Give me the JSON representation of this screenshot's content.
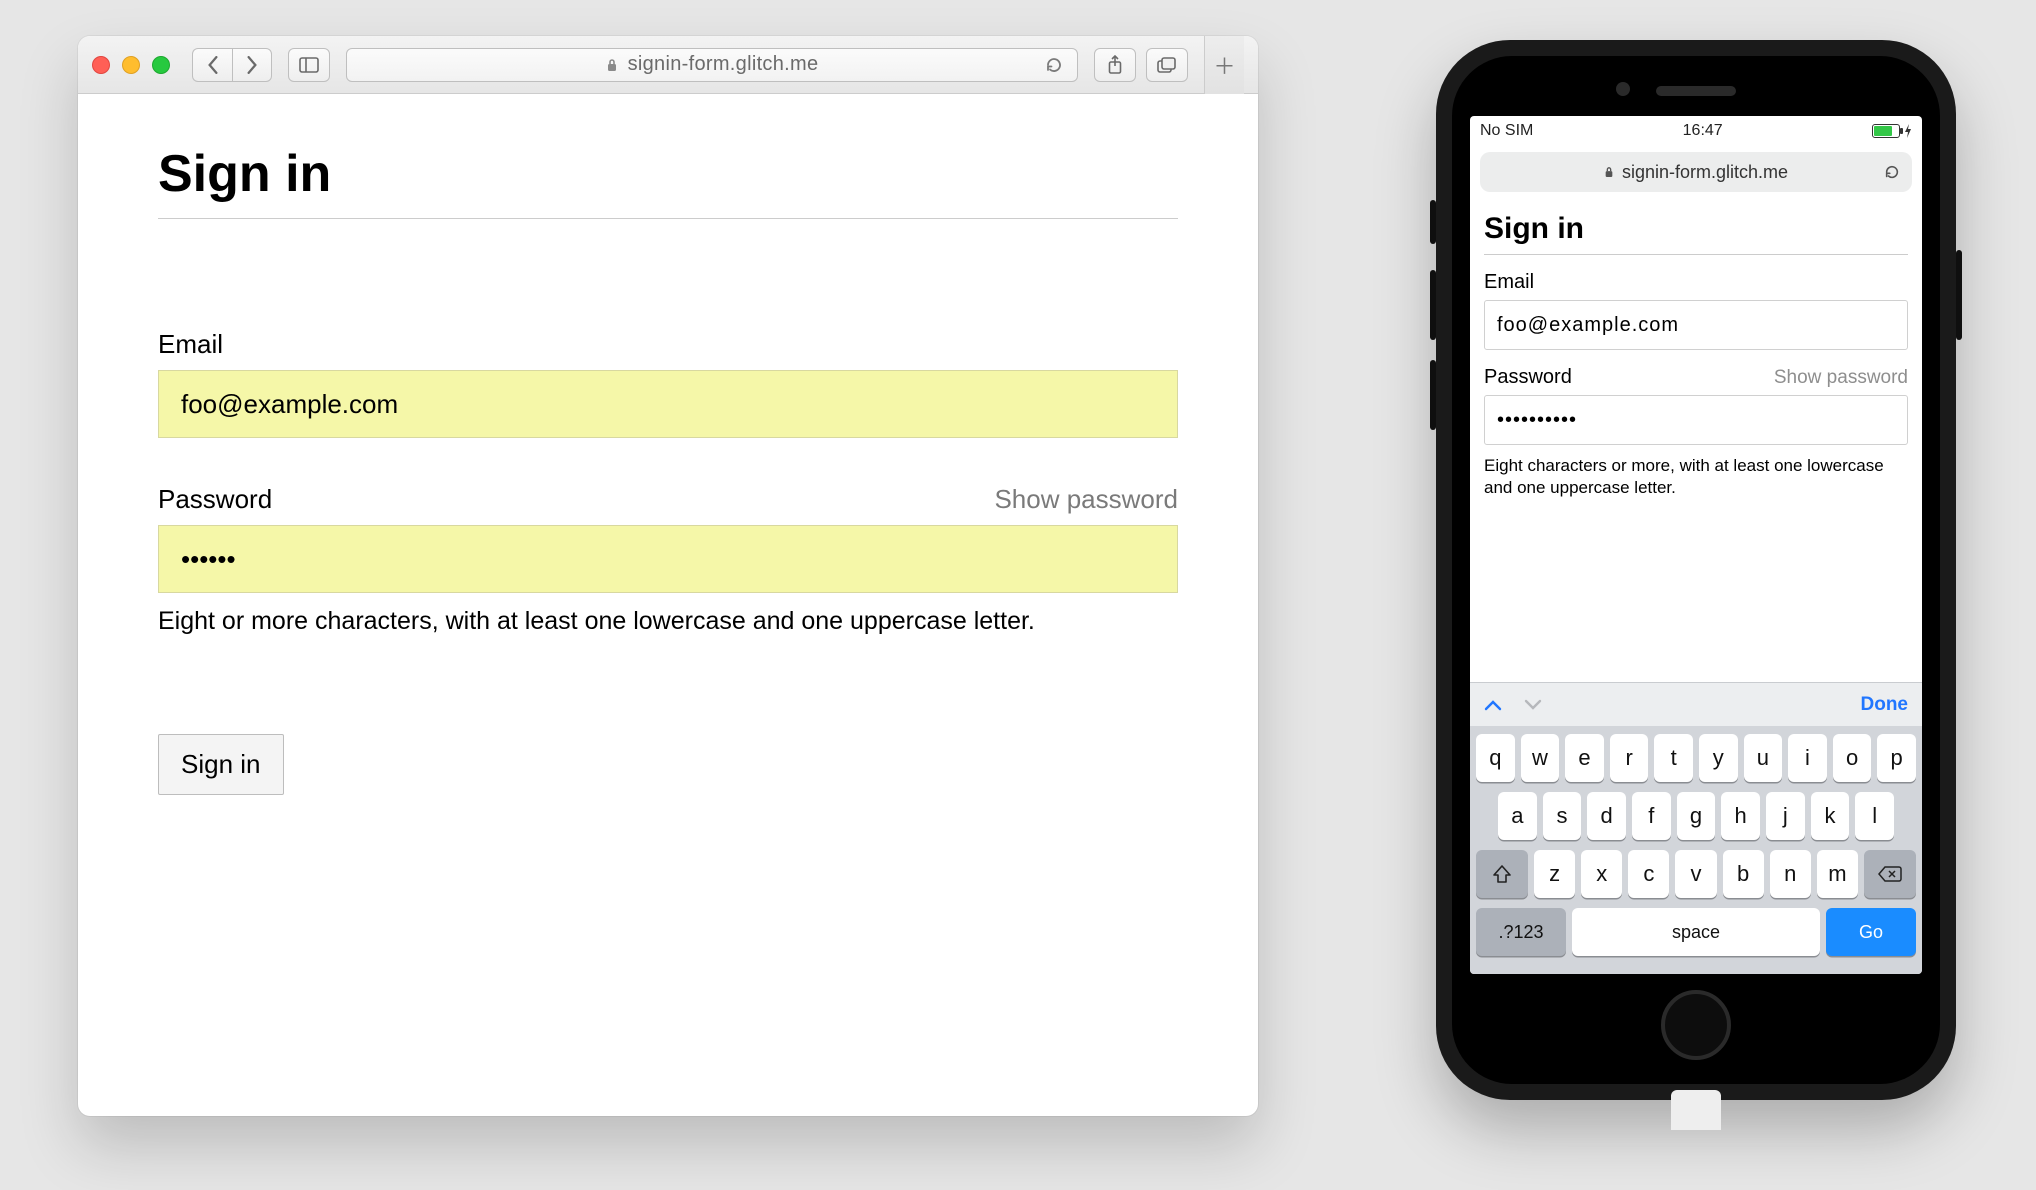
{
  "desktop": {
    "url": "signin-form.glitch.me",
    "page": {
      "title": "Sign in",
      "email_label": "Email",
      "email_value": "foo@example.com",
      "password_label": "Password",
      "show_password": "Show password",
      "password_value": "••••••",
      "password_hint": "Eight or more characters, with at least one lowercase and one uppercase letter.",
      "submit_label": "Sign in"
    }
  },
  "mobile": {
    "status": {
      "carrier": "No SIM",
      "time": "16:47"
    },
    "url": "signin-form.glitch.me",
    "page": {
      "title": "Sign in",
      "email_label": "Email",
      "email_value": "foo@example.com",
      "password_label": "Password",
      "show_password": "Show password",
      "password_value": "••••••••••",
      "password_hint": "Eight characters or more, with at least one lowercase and one uppercase letter."
    },
    "keyboard": {
      "done": "Done",
      "row1": [
        "q",
        "w",
        "e",
        "r",
        "t",
        "y",
        "u",
        "i",
        "o",
        "p"
      ],
      "row2": [
        "a",
        "s",
        "d",
        "f",
        "g",
        "h",
        "j",
        "k",
        "l"
      ],
      "row3": [
        "z",
        "x",
        "c",
        "v",
        "b",
        "n",
        "m"
      ],
      "numbers_key": ".?123",
      "space_key": "space",
      "go_key": "Go"
    }
  }
}
